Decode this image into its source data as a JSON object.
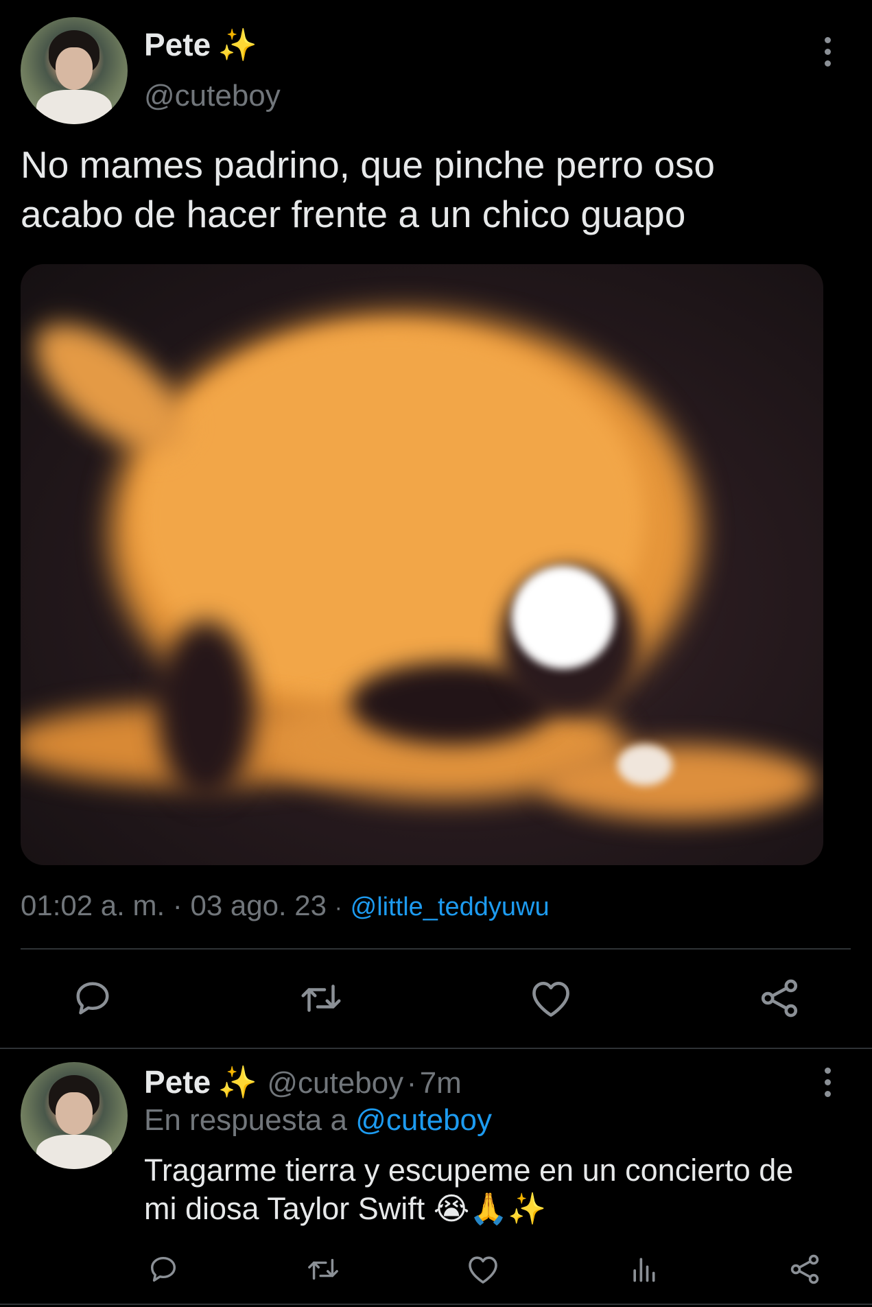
{
  "tweet": {
    "author_name": "Pete",
    "author_emoji": "✨",
    "author_handle": "@cuteboy",
    "text_line1": "No mames padrino, que pinche perro oso",
    "text_line2": "acabo de hacer frente a un chico guapo",
    "time": "01:02 a. m.",
    "sep1": "·",
    "date": "03 ago. 23",
    "sep2": "·",
    "via": "@little_teddyuwu"
  },
  "reply": {
    "author_name": "Pete",
    "author_emoji": "✨",
    "author_handle": "@cuteboy",
    "sep": "·",
    "age": "7m",
    "reply_prefix": "En respuesta a",
    "reply_to": "@cuteboy",
    "text_line1": "Tragarme tierra y escupeme en un concierto de",
    "text_line2": "mi diosa Taylor Swift 😭🙏✨"
  },
  "icons": {
    "reply": "comment-icon",
    "retweet": "retweet-icon",
    "like": "heart-icon",
    "share": "share-icon",
    "views": "analytics-icon",
    "more": "more-vertical-icon"
  },
  "colors": {
    "background": "#000000",
    "text": "#e7e9ea",
    "muted": "#71767b",
    "link": "#1d9bf0",
    "divider": "#2f3336"
  }
}
